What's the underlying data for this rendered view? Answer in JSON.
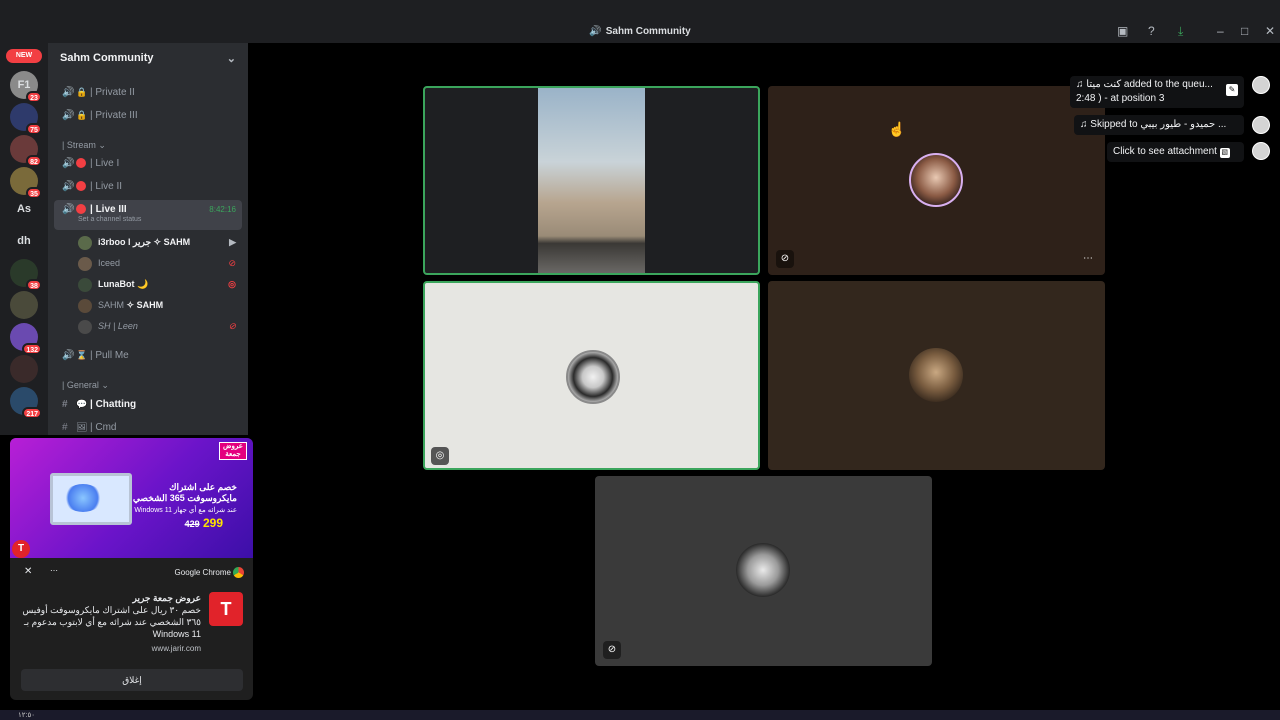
{
  "window": {
    "title": "Sahm Community",
    "title_icon": "speaker-icon",
    "controls": [
      "inbox-icon",
      "help-icon",
      "download-icon",
      "minimize-icon",
      "maximize-icon",
      "close-icon"
    ]
  },
  "guilds": {
    "new_label": "NEW",
    "items": [
      {
        "label": "F1",
        "badge": "23",
        "color": "#8a8a8a"
      },
      {
        "label": "",
        "badge": "75",
        "color": "#2e3a6b"
      },
      {
        "label": "",
        "badge": "82",
        "color": "#6a3a3a"
      },
      {
        "label": "",
        "badge": "35",
        "color": "#7a6a3a"
      },
      {
        "label": "As",
        "badge": "",
        "color": "#1e1f22"
      },
      {
        "label": "dh",
        "badge": "",
        "color": "#1e1f22"
      },
      {
        "label": "",
        "badge": "38",
        "color": "#2a3a2a"
      },
      {
        "label": "",
        "badge": "",
        "color": "#4a4a3a"
      },
      {
        "label": "",
        "badge": "132",
        "color": "#6a4ab0"
      },
      {
        "label": "",
        "badge": "",
        "color": "#3a2a2a"
      },
      {
        "label": "",
        "badge": "217",
        "color": "#2a4a6a"
      }
    ]
  },
  "sidebar": {
    "server_name": "Sahm Community",
    "channels_top": [
      {
        "label": "| Private II"
      },
      {
        "label": "| Private III"
      }
    ],
    "stream_category": "| Stream",
    "stream_channels": [
      {
        "label": "| Live I"
      },
      {
        "label": "| Live II"
      }
    ],
    "active_channel": {
      "label": "| Live III",
      "timer": "8:42:16",
      "status": "Set a channel status"
    },
    "members": [
      {
        "name": "i3rboo l جرير",
        "tag": "SAHM"
      },
      {
        "name": "Iceed",
        "tag": ""
      },
      {
        "name": "LunaBot 🌙",
        "tag": ""
      },
      {
        "name": "SAHM",
        "tag": "SAHM"
      },
      {
        "name": "SH | Leen",
        "tag": ""
      }
    ],
    "pull_me": "| Pull Me",
    "general_category": "| General",
    "text_channels": [
      {
        "label": "| Chatting"
      },
      {
        "label": "| Cmd"
      }
    ]
  },
  "notifications": [
    {
      "text": "كنت ميتا added to the queu...",
      "text2": "2:48 ) - at position 3"
    },
    {
      "text": "Skipped to حميدو - طيور بيبي ..."
    },
    {
      "text": "Click to see attachment"
    }
  ],
  "chrome_notification": {
    "app": "Google Chrome",
    "title": "عروض جمعة جرير",
    "body": "خصم ٣٠ ريال على اشتراك مايكروسوفت أوفيس ٣٦٥ الشخصي عند شرائه مع أي لابتوب مدعوم بـ Windows 11",
    "site": "www.jarir.com",
    "button": "إغلاق",
    "ad": {
      "tag": "عروض جمعة",
      "headline": "خصم على اشتراك مايكروسوفت 365 الشخصي",
      "sub": "عند شرائه مع أي جهاز Windows 11",
      "price_old": "429",
      "price_new": "299"
    }
  },
  "taskbar": {
    "time": "١٢:٥٠"
  }
}
